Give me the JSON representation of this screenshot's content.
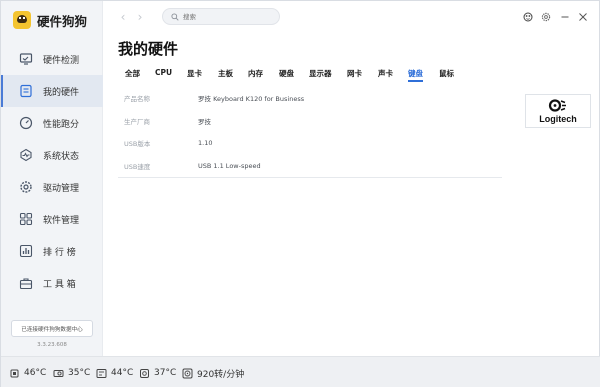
{
  "app": {
    "name": "硬件狗狗",
    "version": "3.3.23.608"
  },
  "sidebar": {
    "items": [
      {
        "label": "硬件检测",
        "icon": "monitor-icon"
      },
      {
        "label": "我的硬件",
        "icon": "my-hardware-icon"
      },
      {
        "label": "性能跑分",
        "icon": "speedometer-icon"
      },
      {
        "label": "系统状态",
        "icon": "pulse-icon"
      },
      {
        "label": "驱动管理",
        "icon": "gear-icon"
      },
      {
        "label": "软件管理",
        "icon": "apps-grid-icon"
      },
      {
        "label": "排 行 榜",
        "icon": "ranking-icon"
      },
      {
        "label": "工 具 箱",
        "icon": "toolbox-icon"
      }
    ],
    "active_index": 1,
    "data_center_label": "已连接硬件狗狗数据中心"
  },
  "search": {
    "placeholder": "搜索"
  },
  "page": {
    "title": "我的硬件"
  },
  "tabs": [
    {
      "label": "全部"
    },
    {
      "label": "CPU"
    },
    {
      "label": "显卡"
    },
    {
      "label": "主板"
    },
    {
      "label": "内存"
    },
    {
      "label": "硬盘"
    },
    {
      "label": "显示器"
    },
    {
      "label": "网卡"
    },
    {
      "label": "声卡"
    },
    {
      "label": "键盘"
    },
    {
      "label": "鼠标"
    }
  ],
  "active_tab": "键盘",
  "properties": [
    {
      "key": "产品名称",
      "value": "罗技 Keyboard K120 for Business"
    },
    {
      "key": "生产厂商",
      "value": "罗技"
    },
    {
      "key": "USB版本",
      "value": "1.10"
    },
    {
      "key": "USB速度",
      "value": "USB 1.1 Low-speed"
    }
  ],
  "brand_logo": {
    "text": "Logitech",
    "icon": "logitech-logo"
  },
  "statusbar": [
    {
      "label": "46°C",
      "icon": "cpu-temp-icon"
    },
    {
      "label": "35°C",
      "icon": "gpu-temp-icon"
    },
    {
      "label": "44°C",
      "icon": "board-temp-icon"
    },
    {
      "label": "37°C",
      "icon": "disk-temp-icon"
    },
    {
      "label": "920转/分钟",
      "icon": "fan-icon"
    }
  ],
  "colors": {
    "accent": "#2f6fd8",
    "sidebar_bg": "#f2f4f7",
    "statusbar_bg": "#eef0f3"
  }
}
